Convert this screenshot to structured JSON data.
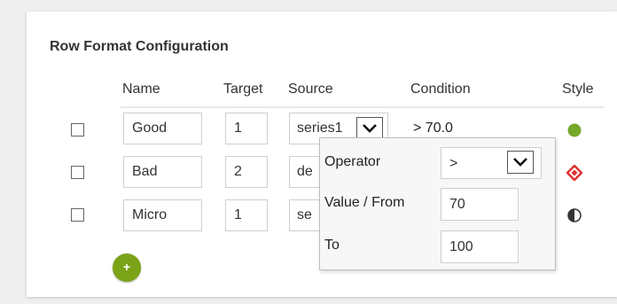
{
  "title": "Row Format Configuration",
  "columns": {
    "name": "Name",
    "target": "Target",
    "source": "Source",
    "condition": "Condition",
    "style": "Style"
  },
  "rows": [
    {
      "name": "Good",
      "target": "1",
      "source": "series1",
      "condition": "> 70.0",
      "style_icon": "green-circle-icon"
    },
    {
      "name": "Bad",
      "target": "2",
      "source": "de",
      "condition": "",
      "style_icon": "red-diamond-icon"
    },
    {
      "name": "Micro",
      "target": "1",
      "source": "se",
      "condition": "",
      "style_icon": "half-circle-icon"
    }
  ],
  "popup": {
    "operator_label": "Operator",
    "operator_value": ">",
    "value_from_label": "Value / From",
    "value_from": "70",
    "to_label": "To",
    "to_value": "100"
  },
  "add_button_label": "+",
  "colors": {
    "accent_green": "#7aa317",
    "style_green": "#76a82a",
    "style_red": "#e0312f",
    "style_dark": "#333333"
  }
}
